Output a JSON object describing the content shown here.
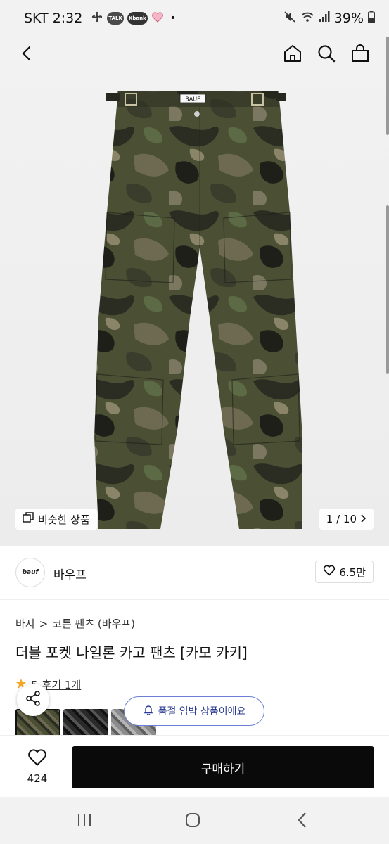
{
  "status": {
    "carrier_time": "SKT 2:32",
    "notif_icons": [
      "fan-icon",
      "talk-icon",
      "kbank-icon",
      "heart-icon"
    ],
    "talk_label": "TALK",
    "kbank_label": "Kbank",
    "dot": "•",
    "battery": "39%"
  },
  "header": {
    "icons": [
      "back-icon",
      "home-icon",
      "search-icon",
      "bag-icon"
    ]
  },
  "gallery": {
    "similar_label": "비슷한 상품",
    "page_indicator": "1 / 10",
    "waistband_label": "BAUF"
  },
  "brand": {
    "logo_text": "bauf",
    "name": "바우프",
    "like_count": "6.5만"
  },
  "breadcrumb": {
    "category": "바지",
    "separator": ">",
    "subcategory": "코튼 팬츠 (바우프)"
  },
  "product": {
    "title": "더블 포켓 나일론 카고 팬츠 [카모 카키]",
    "rating_partial": "5",
    "review_text": "후기 1개"
  },
  "toast": {
    "text": "품절 임박 상품이에요"
  },
  "bottom": {
    "wish_count": "424",
    "buy_label": "구매하기"
  },
  "nav": {
    "icons": [
      "recent-apps-icon",
      "home-nav-icon",
      "back-nav-icon"
    ]
  },
  "colors": {
    "buy_button": "#0a0a0a",
    "toast_border": "#6b7fd6",
    "toast_text": "#2a3b95",
    "rating_star": "#f5a623"
  }
}
